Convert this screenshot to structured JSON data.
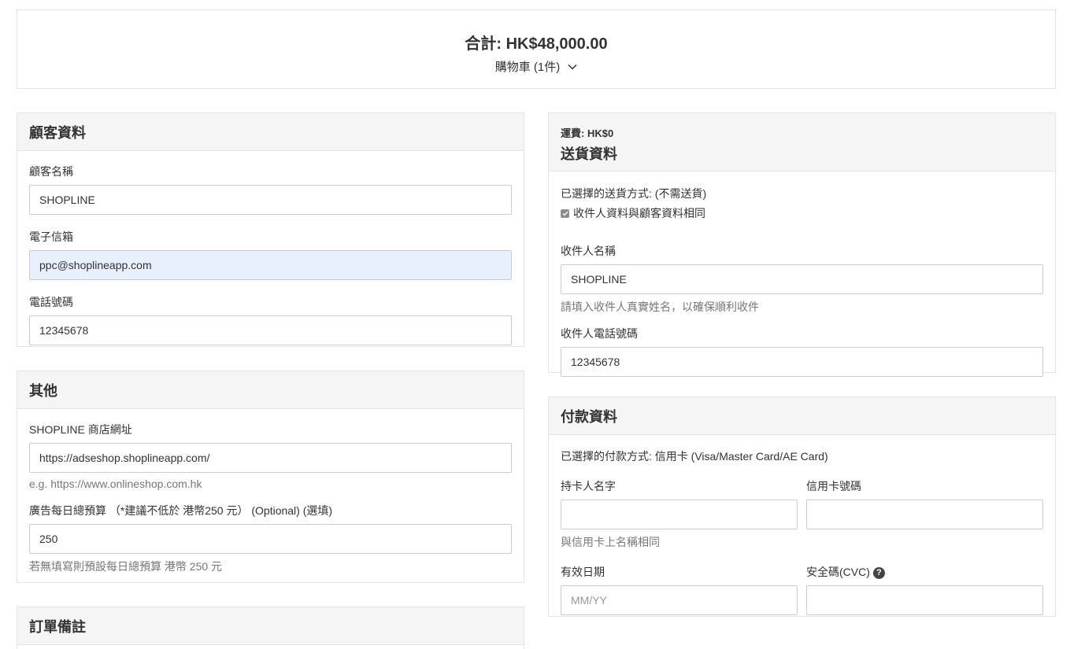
{
  "summary": {
    "total": "合計: HK$48,000.00",
    "cart_label": "購物車 (1件)"
  },
  "customer": {
    "title": "顧客資料",
    "name_label": "顧客名稱",
    "name_value": "SHOPLINE",
    "email_label": "電子信箱",
    "email_value": "ppc@shoplineapp.com",
    "phone_label": "電話號碼",
    "phone_value": "12345678"
  },
  "other": {
    "title": "其他",
    "url_label": "SHOPLINE 商店網址",
    "url_value": "https://adseshop.shoplineapp.com/",
    "url_help": "e.g. https://www.onlineshop.com.hk",
    "budget_label": "廣告每日總預算 （*建議不低於 港幣250 元） (Optional) (選填)",
    "budget_value": "250",
    "budget_help": "若無填寫則預設每日總預算 港幣 250 元"
  },
  "notes": {
    "title": "訂單備註"
  },
  "delivery": {
    "fee": "運費: HK$0",
    "title": "送貨資料",
    "method": "已選擇的送貨方式: (不需送貨)",
    "same_as_customer": "收件人資料與顧客資料相同",
    "recipient_label": "收件人名稱",
    "recipient_value": "SHOPLINE",
    "recipient_help": "請填入收件人真實姓名，以確保順利收件",
    "recipient_phone_label": "收件人電話號碼",
    "recipient_phone_value": "12345678"
  },
  "payment": {
    "title": "付款資料",
    "method": "已選擇的付款方式: 信用卡 (Visa/Master Card/AE Card)",
    "holder_label": "持卡人名字",
    "holder_help": "與信用卡上名稱相同",
    "card_label": "信用卡號碼",
    "expiry_label": "有效日期",
    "expiry_placeholder": "MM/YY",
    "cvc_label": "安全碼(CVC)",
    "help_glyph": "?"
  },
  "icons": {
    "cart_toggle": "chevron-down-icon",
    "checkbox": "check-icon",
    "cvc_help": "question-circle-icon"
  }
}
